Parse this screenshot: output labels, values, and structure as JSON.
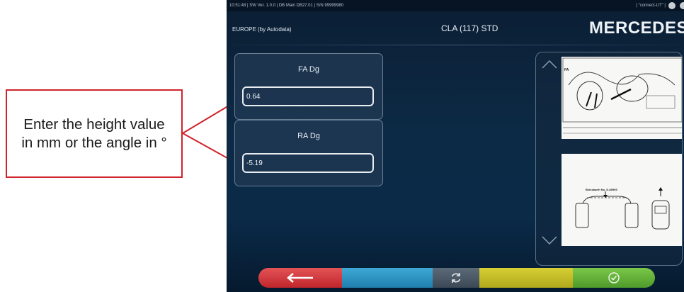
{
  "callout": {
    "line1": "Enter the height value",
    "line2": "in mm or the angle in °",
    "color": "#d0242b"
  },
  "status_bar": {
    "left": "10:51:48  |  SW Ver. 1.0.0  |  DB Main DB27.01  |  S/N 99999980",
    "right": "|  \"connect-UT\"  |"
  },
  "header": {
    "region": "EUROPE (by Autodata)",
    "model": "CLA (117) STD",
    "brand": "MERCEDES"
  },
  "params": [
    {
      "label": "FA Dg",
      "value": "0.64"
    },
    {
      "label": "RA Dg",
      "value": "-5.19"
    }
  ],
  "diagram": {
    "top_label": "FA",
    "bottom_label": "Beissbarth No. D-80993"
  },
  "toolbar": {
    "back_icon": "back-arrow-icon",
    "refresh_icon": "refresh-icon",
    "confirm_icon": "check-icon",
    "colors": {
      "back": "#c9353a",
      "blue": "#2f93c2",
      "refresh": "#4a5866",
      "yellow": "#c6be28",
      "ok": "#63b23a"
    }
  }
}
